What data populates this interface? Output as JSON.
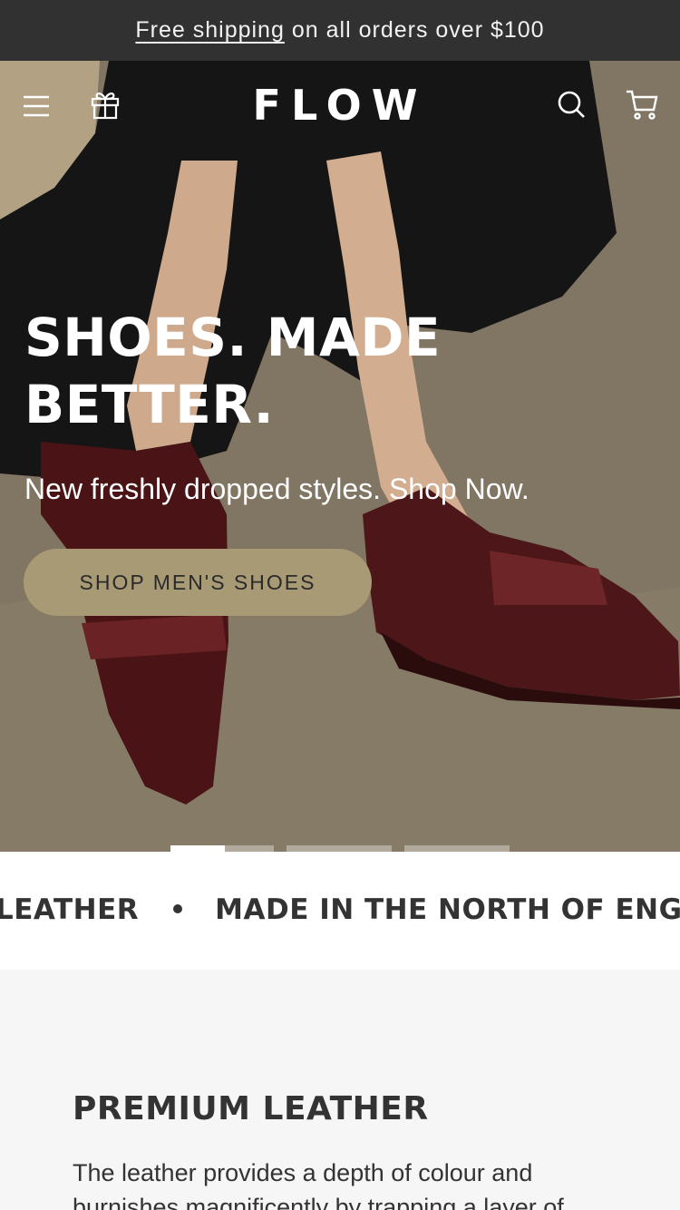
{
  "announcement": {
    "link_text": "Free shipping",
    "rest_text": "on all orders over $100"
  },
  "header": {
    "brand": "FLOW",
    "icons": [
      "menu-icon",
      "gift-icon",
      "search-icon",
      "cart-icon"
    ]
  },
  "hero": {
    "headline": "SHOES. MADE BETTER.",
    "subline": "New freshly dropped styles. Shop Now.",
    "cta_label": "SHOP MEN'S SHOES",
    "slides_total": 4,
    "active_slide": 1
  },
  "ticker": {
    "items": [
      "LEATHER",
      "MADE IN THE NORTH OF ENGLAND"
    ]
  },
  "section": {
    "title": "PREMIUM LEATHER",
    "body": "The leather provides a depth of colour and burnishes magnificently by trapping a layer of"
  },
  "colors": {
    "announcement_bg": "#313131",
    "cta_bg": "#a89a75",
    "section_bg": "#f6f6f6"
  }
}
